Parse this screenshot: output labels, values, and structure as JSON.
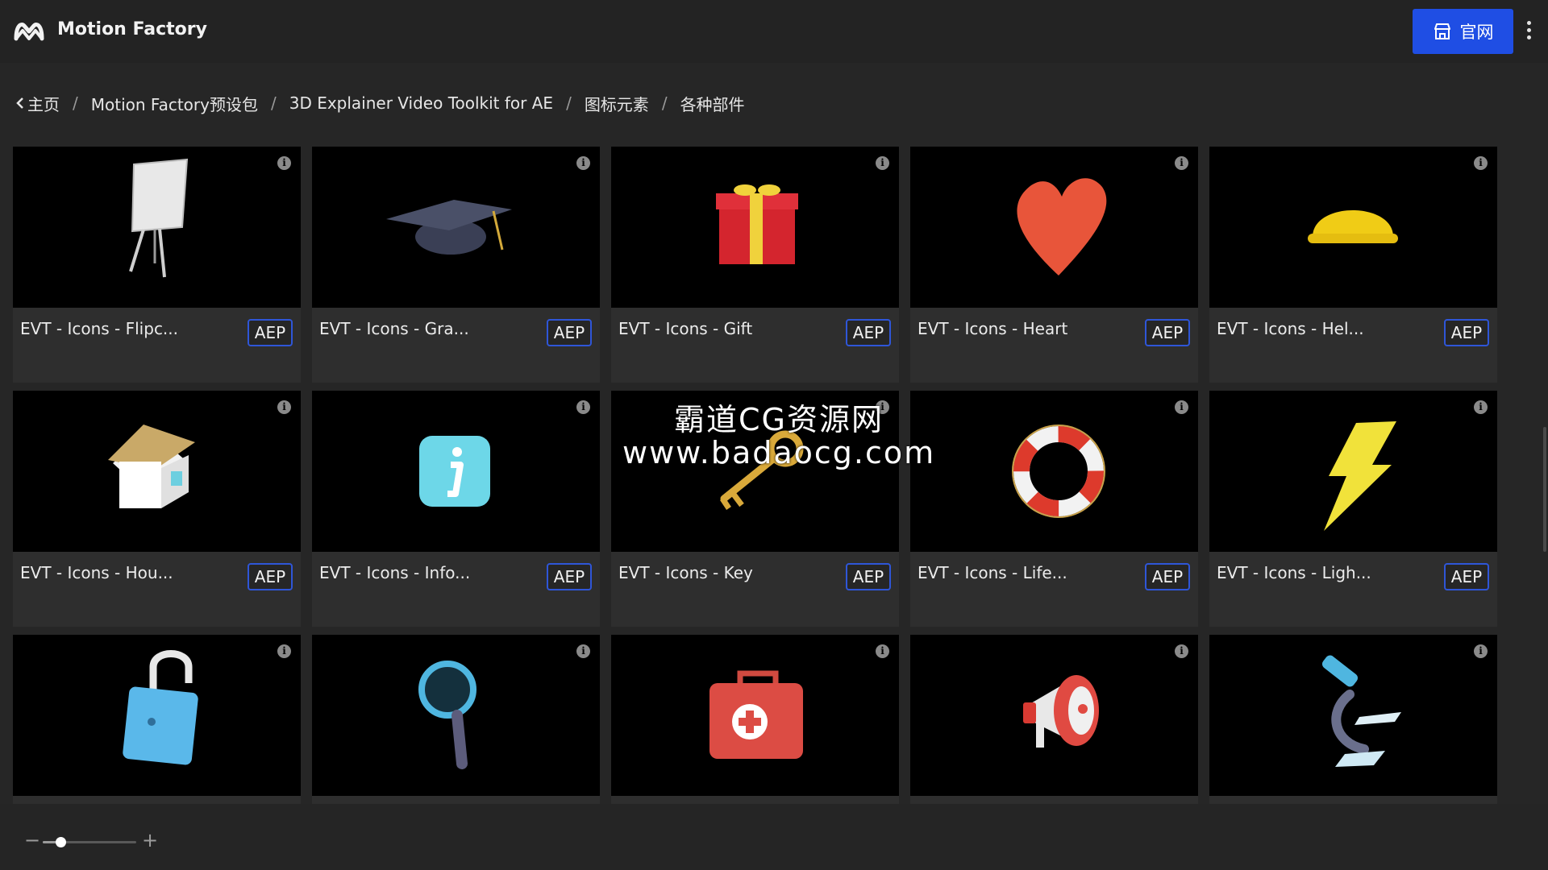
{
  "header": {
    "app_title": "Motion Factory",
    "site_button_label": "官网",
    "site_button_icon": "store-icon",
    "more_icon": "vertical-dots-icon",
    "accent_color": "#1f4ee4"
  },
  "breadcrumb": {
    "back_icon": "chevron-left-icon",
    "items": [
      "主页",
      "Motion Factory预设包",
      "3D Explainer Video Toolkit for AE",
      "图标元素",
      "各种部件"
    ],
    "separator": "/"
  },
  "grid": {
    "cards": [
      {
        "title": "EVT - Icons - Flipc...",
        "badge": "AEP",
        "icon": "flipchart-icon"
      },
      {
        "title": "EVT - Icons - Gra...",
        "badge": "AEP",
        "icon": "graduation-cap-icon"
      },
      {
        "title": "EVT - Icons - Gift",
        "badge": "AEP",
        "icon": "gift-icon"
      },
      {
        "title": "EVT - Icons - Heart",
        "badge": "AEP",
        "icon": "heart-icon"
      },
      {
        "title": "EVT - Icons - Hel...",
        "badge": "AEP",
        "icon": "helmet-icon"
      },
      {
        "title": "EVT - Icons - Hou...",
        "badge": "AEP",
        "icon": "house-icon"
      },
      {
        "title": "EVT - Icons - Info...",
        "badge": "AEP",
        "icon": "info-icon"
      },
      {
        "title": "EVT - Icons - Key",
        "badge": "AEP",
        "icon": "key-icon"
      },
      {
        "title": "EVT - Icons - Life...",
        "badge": "AEP",
        "icon": "lifebuoy-icon"
      },
      {
        "title": "EVT - Icons - Ligh...",
        "badge": "AEP",
        "icon": "lightning-icon"
      },
      {
        "title": "",
        "badge": "",
        "icon": "padlock-open-icon"
      },
      {
        "title": "",
        "badge": "",
        "icon": "magnifier-icon"
      },
      {
        "title": "",
        "badge": "",
        "icon": "first-aid-kit-icon"
      },
      {
        "title": "",
        "badge": "",
        "icon": "megaphone-icon"
      },
      {
        "title": "",
        "badge": "",
        "icon": "microscope-icon"
      }
    ]
  },
  "watermark": {
    "line1": "霸道CG资源网",
    "line2": "www.badaocg.com"
  },
  "footer": {
    "zoom_minus": "−",
    "zoom_plus": "+",
    "zoom_level": 0.19
  }
}
